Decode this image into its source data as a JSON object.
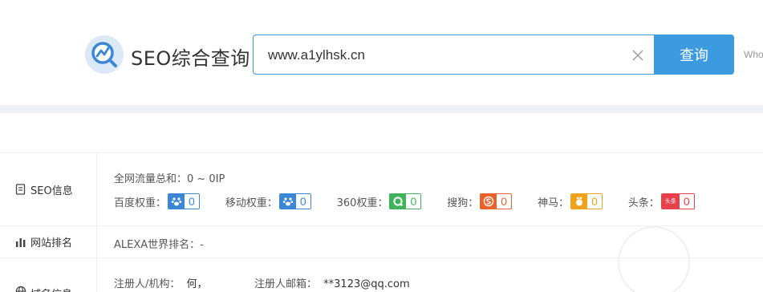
{
  "header": {
    "brand": "SEO综合查询",
    "search_value": "www.a1ylhsk.cn",
    "search_button": "查询",
    "who_link": "Who"
  },
  "rows": {
    "seo": {
      "label": "SEO信息",
      "traffic": "全网流量总和：0 ~ 0IP",
      "weights": [
        {
          "label": "百度权重：",
          "value": "0",
          "icon": "paw-icon",
          "color": "#3b87d6"
        },
        {
          "label": "移动权重：",
          "value": "0",
          "icon": "paw-icon",
          "color": "#3b87d6"
        },
        {
          "label": "360权重：",
          "value": "0",
          "icon": "360-icon",
          "color": "#3fb35a"
        },
        {
          "label": "搜狗：",
          "value": "0",
          "icon": "sogou-icon",
          "color": "#e8622a"
        },
        {
          "label": "神马：",
          "value": "0",
          "icon": "shenma-icon",
          "color": "#f0a21b"
        },
        {
          "label": "头条：",
          "value": "0",
          "icon": "toutiao-icon",
          "icon_text": "头条",
          "color": "#e8404a"
        }
      ]
    },
    "rank": {
      "label": "网站排名",
      "alexa": "ALEXA世界排名：-"
    },
    "whois": {
      "label": "域名信息",
      "registrant_label": "注册人/机构：",
      "registrant_value": "何，",
      "email_label": "注册人邮箱：",
      "email_value": "**3123@qq.com"
    }
  },
  "colors": {
    "accent": "#3b9ae0",
    "border": "#eceff3"
  }
}
